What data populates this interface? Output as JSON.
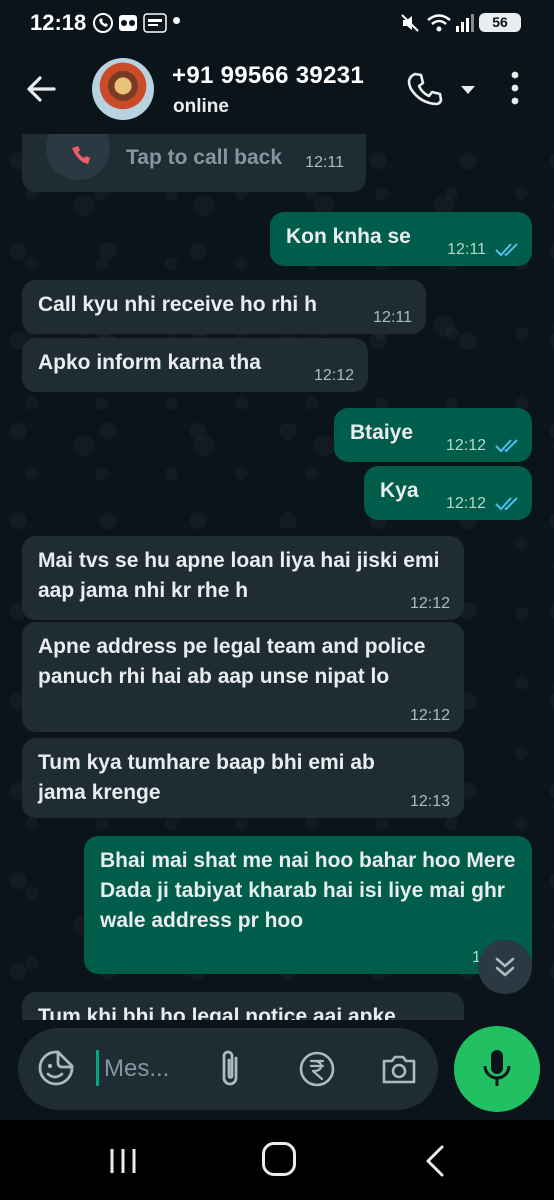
{
  "status_bar": {
    "time": "12:18",
    "battery": "56"
  },
  "header": {
    "contact_name": "+91 99566 39231",
    "status": "online"
  },
  "call_bubble": {
    "label": "Tap to call back",
    "time": "12:11"
  },
  "messages": [
    {
      "dir": "out",
      "text": "Kon knha se",
      "time": "12:11"
    },
    {
      "dir": "in",
      "text": "Call kyu nhi receive ho rhi h",
      "time": "12:11"
    },
    {
      "dir": "in",
      "text": "Apko inform karna tha",
      "time": "12:12"
    },
    {
      "dir": "out",
      "text": "Btaiye",
      "time": "12:12"
    },
    {
      "dir": "out",
      "text": "Kya",
      "time": "12:12"
    },
    {
      "dir": "in",
      "text": "Mai tvs se hu apne loan liya hai jiski emi aap jama nhi kr rhe h",
      "time": "12:12"
    },
    {
      "dir": "in",
      "text": "Apne address pe legal team and police panuch rhi hai ab aap unse nipat lo",
      "time": "12:12"
    },
    {
      "dir": "in",
      "text": "Tum kya tumhare baap bhi emi ab jama krenge",
      "time": "12:13"
    },
    {
      "dir": "out",
      "text": "Bhai mai shat me nai hoo bahar hoo Mere Dada ji tabiyat kharab hai isi liye mai ghr wale address pr hoo",
      "time": "12:13"
    },
    {
      "dir": "in",
      "text": "Tum khi bhi ho legal notice aai apke",
      "time": ""
    }
  ],
  "input": {
    "placeholder": "Mes..."
  },
  "colors": {
    "background": "#0b141a",
    "incoming_bubble": "#202c33",
    "outgoing_bubble": "#005c4b",
    "read_ticks": "#53bdeb",
    "mic_button": "#21c063"
  }
}
